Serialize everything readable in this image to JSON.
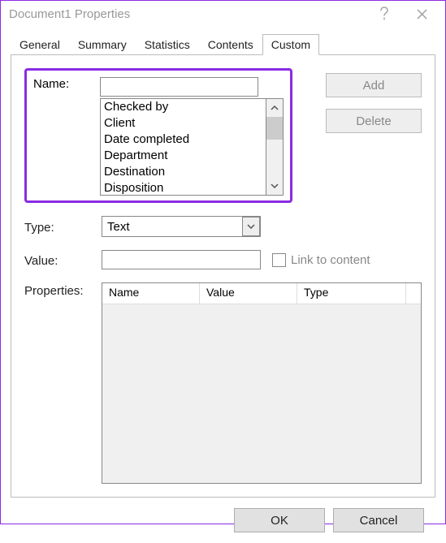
{
  "window": {
    "title": "Document1 Properties"
  },
  "tabs": {
    "items": [
      "General",
      "Summary",
      "Statistics",
      "Contents",
      "Custom"
    ],
    "active": "Custom"
  },
  "labels": {
    "name": "Name:",
    "type": "Type:",
    "value": "Value:",
    "properties": "Properties:",
    "link": "Link to content"
  },
  "name_input": "",
  "name_suggestions": [
    "Checked by",
    "Client",
    "Date completed",
    "Department",
    "Destination",
    "Disposition"
  ],
  "type_select": {
    "value": "Text"
  },
  "value_input": "",
  "buttons": {
    "add": "Add",
    "delete": "Delete",
    "ok": "OK",
    "cancel": "Cancel"
  },
  "table": {
    "columns": [
      "Name",
      "Value",
      "Type"
    ],
    "rows": []
  }
}
